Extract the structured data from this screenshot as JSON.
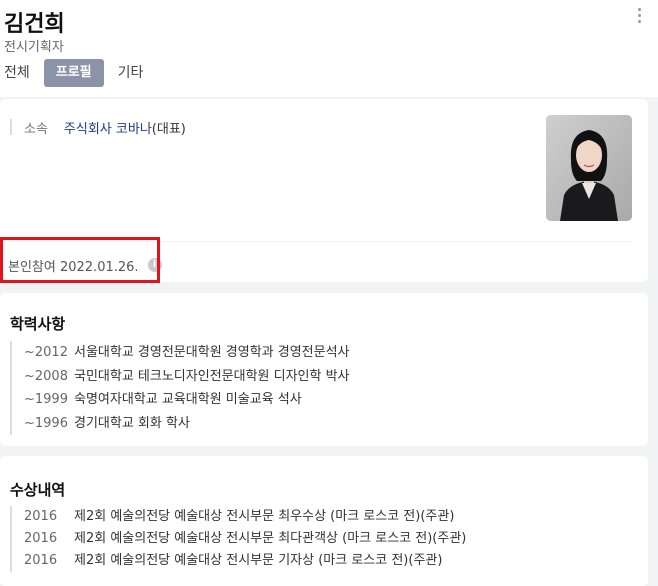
{
  "profile": {
    "name": "김건희",
    "job": "전시기획자"
  },
  "tabs": [
    {
      "label": "전체",
      "active": false
    },
    {
      "label": "프로필",
      "active": true
    },
    {
      "label": "기타",
      "active": false
    }
  ],
  "affiliation": {
    "label": "소속",
    "company": "주식회사 코바나",
    "role": "(대표)"
  },
  "verification": {
    "text": "본인참여 2022.01.26.",
    "icon": "info-icon"
  },
  "education": {
    "title": "학력사항",
    "items": [
      {
        "year": "~2012",
        "text": "서울대학교 경영전문대학원 경영학과 경영전문석사"
      },
      {
        "year": "~2008",
        "text": "국민대학교 테크노디자인전문대학원 디자인학 박사"
      },
      {
        "year": "~1999",
        "text": "숙명여자대학교 교육대학원 미술교육 석사"
      },
      {
        "year": "~1996",
        "text": "경기대학교 회화 학사"
      }
    ]
  },
  "awards": {
    "title": "수상내역",
    "items": [
      {
        "year": "2016",
        "text": "제2회 예술의전당 예술대상 전시부문 최우수상 (마크 로스코 전)(주관)"
      },
      {
        "year": "2016",
        "text": "제2회 예술의전당 예술대상 전시부문 최다관객상 (마크 로스코 전)(주관)"
      },
      {
        "year": "2016",
        "text": "제2회 예술의전당 예술대상 전시부문 기자상 (마크 로스코 전)(주관)"
      }
    ]
  },
  "colors": {
    "accent_tab": "#8a93a8",
    "link": "#1e3c8c",
    "highlight_box": "#e0141e"
  }
}
